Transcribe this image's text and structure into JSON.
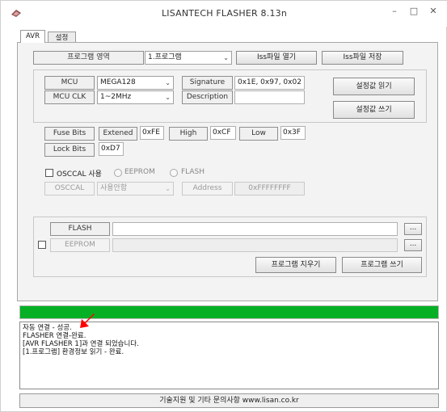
{
  "window": {
    "title": "LISANTECH FLASHER 8.13n",
    "min_glyph": "–",
    "max_glyph": "□",
    "close_glyph": "✕"
  },
  "tabs": [
    {
      "label": "AVR",
      "active": true
    },
    {
      "label": "설정",
      "active": false
    }
  ],
  "program_area": {
    "label": "프로그램 영역",
    "selected": "1.프로그램",
    "open_iss_label": "Iss파일 열기",
    "save_iss_label": "Iss파일 저장"
  },
  "device": {
    "mcu_label": "MCU",
    "mcu_value": "MEGA128",
    "mcu_clk_label": "MCU CLK",
    "mcu_clk_value": "1~2MHz",
    "signature_label": "Signature",
    "signature_value": "0x1E, 0x97, 0x02",
    "description_label": "Description",
    "description_value": "",
    "read_settings_label": "설정값 읽기",
    "write_settings_label": "설정값 쓰기"
  },
  "fuse": {
    "fuse_bits_label": "Fuse Bits",
    "extended_label": "Extened",
    "extended_value": "0xFE",
    "high_label": "High",
    "high_value": "0xCF",
    "low_label": "Low",
    "low_value": "0x3F",
    "lock_bits_label": "Lock Bits",
    "lock_bits_value": "0xD7"
  },
  "osccal": {
    "use_label": "OSCCAL 사용",
    "eeprom_radio_label": "EEPROM",
    "flash_radio_label": "FLASH",
    "osccal_label": "OSCCAL",
    "mode_value": "사용안함",
    "address_label": "Address",
    "address_value": "0xFFFFFFFF"
  },
  "files": {
    "flash_label": "FLASH",
    "flash_path": "",
    "eeprom_label": "EEPROM",
    "eeprom_path": "",
    "browse_label": "...",
    "erase_label": "프로그램 지우기",
    "write_label": "프로그램 쓰기"
  },
  "progress": {
    "value": 1.0,
    "color": "#06b025"
  },
  "log": [
    "자동 연결 - 성공.",
    "FLASHER 연결-완료.",
    "[AVR FLASHER 1]과 연결 되었습니다.",
    "[1.프로그램] 환경정보 읽기 - 완료."
  ],
  "footer": {
    "text": "기술지원 및 기타 문의사항 www.lisan.co.kr"
  },
  "colors": {
    "accent_arrow": "#ff0000",
    "progress": "#06b025"
  }
}
